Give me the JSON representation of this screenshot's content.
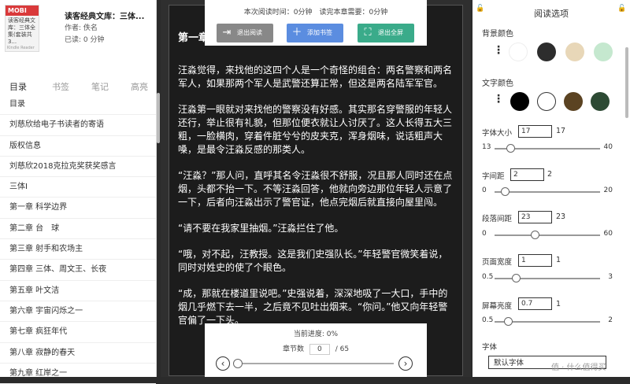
{
  "book": {
    "cover_badge": "MOBI",
    "cover_title": "读客经典文库：三体全集(套装共3...",
    "cover_brand": "Kindle Reader",
    "title": "读客经典文库：三体...",
    "author": "作者: 佚名",
    "read_time": "已读: 0 分钟"
  },
  "tabs": [
    "目录",
    "书签",
    "笔记",
    "高亮"
  ],
  "toc": [
    "目录",
    "刘慈欣给电子书读者的寄语",
    "版权信息",
    "刘慈欣2018克拉克奖获奖感言",
    "三体I",
    "第一章 科学边界",
    "第二章 台　球",
    "第三章 射手和农场主",
    "第四章 三体、周文王、长夜",
    "第五章 叶文洁",
    "第六章 宇宙闪烁之一",
    "第七章 疯狂年代",
    "第八章 寂静的春天",
    "第九章 红岸之一"
  ],
  "top_bar": {
    "info": "本次阅读时间：0分钟　读完本章需要：0分钟",
    "exit_read": "退出阅读",
    "add_bookmark": "添加书签",
    "exit_fullscreen": "退出全屏",
    "exit_read_color": "#888888",
    "add_bookmark_color": "#5b8de0",
    "exit_fullscreen_color": "#3aab8a"
  },
  "content": {
    "chapter_title": "第一章",
    "paragraphs": [
      "汪淼觉得，来找他的这四个人是一个奇怪的组合：两名警察和两名军人，如果那两个军人是武警还算正常，但这是两名陆军军官。",
      "汪淼第一眼就对来找他的警察没有好感。其实那名穿警服的年轻人还行，举止很有礼貌，但那位便衣就让人讨厌了。这人长得五大三粗，一脸横肉，穿着件脏兮兮的皮夹克，浑身烟味，说话粗声大嗓，是最令汪淼反感的那类人。",
      "“汪淼？”那人问，直呼其名令汪淼很不舒服，况且那人同时还在点烟，头都不抬一下。不等汪淼回答，他就向旁边那位年轻人示意了一下，后者向汪淼出示了警官证，他点完烟后就直接向屋里闯。",
      "“请不要在我家里抽烟。”汪淼拦住了他。",
      "“哦，对不起，汪教授。这是我们史强队长。”年轻警官微笑着说，同时对姓史的使了个眼色。",
      "“成，那就在楼道里说吧。”史强说着，深深地吸了一大口，手中的烟几乎燃下去一半，之后竟不见吐出烟来。“你问。”他又向年轻警官偏了一下头。"
    ]
  },
  "bottom_bar": {
    "progress_label": "当前进度: 0%",
    "chapter_label": "章节数",
    "chapter_current": "0",
    "chapter_total": "/ 65",
    "progress": 0
  },
  "settings": {
    "title": "阅读选项",
    "bg_label": "背景颜色",
    "bg_colors": [
      "#ffffff",
      "#2d2d2d",
      "#e8d7b8",
      "#c5e8cf"
    ],
    "text_label": "文字颜色",
    "text_colors": [
      "#000000",
      "#ffffff",
      "#5b4322",
      "#2d4a34"
    ],
    "font_size": {
      "label": "字体大小",
      "value": "17",
      "display": "17",
      "min": "13",
      "max": "40",
      "level": 0.15
    },
    "letter_spacing": {
      "label": "字间距",
      "value": "2",
      "display": "2",
      "min": "0",
      "max": "20",
      "level": 0.1
    },
    "para_spacing": {
      "label": "段落间距",
      "value": "23",
      "display": "23",
      "min": "0",
      "max": "60",
      "level": 0.38
    },
    "page_width": {
      "label": "页面宽度",
      "value": "1",
      "display": "1",
      "min": "0.5",
      "max": "3",
      "level": 0.2
    },
    "brightness": {
      "label": "屏幕亮度",
      "value": "0.7",
      "display": "1",
      "min": "0.5",
      "max": "2",
      "level": 0.13
    },
    "font_label": "字体",
    "font_value": "默认字体"
  },
  "watermark": "值 · 什么值得买"
}
